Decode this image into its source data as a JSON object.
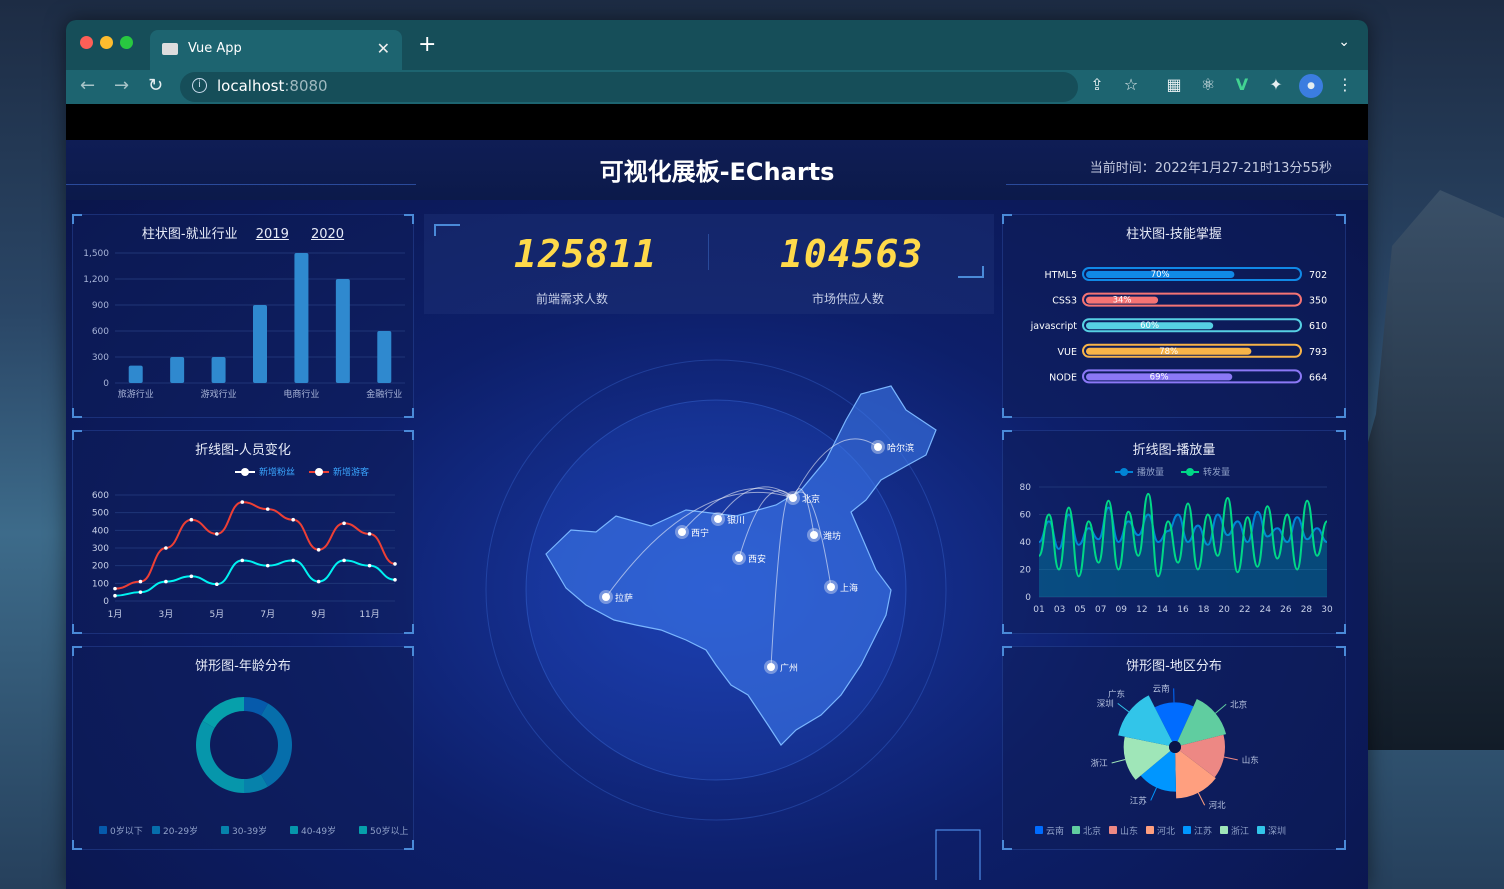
{
  "browser": {
    "tab_title": "Vue App",
    "url_host": "localhost",
    "url_port": ":8080"
  },
  "header": {
    "title": "可视化展板-ECharts",
    "time": "当前时间：2022年1月27-21时13分55秒"
  },
  "stats": [
    {
      "value": "125811",
      "label": "前端需求人数"
    },
    {
      "value": "104563",
      "label": "市场供应人数"
    }
  ],
  "bar1": {
    "title": "柱状图-就业行业",
    "years": [
      "2019",
      "2020"
    ],
    "chart_data": {
      "type": "bar",
      "categories": [
        "旅游行业",
        "",
        "游戏行业",
        "",
        "电商行业",
        "",
        "金融行业"
      ],
      "values": [
        200,
        300,
        300,
        900,
        1500,
        1200,
        600
      ],
      "yticks": [
        "0",
        "300",
        "600",
        "900",
        "1,200",
        "1,500"
      ],
      "ylim": [
        0,
        1500
      ]
    }
  },
  "line1": {
    "title": "折线图-人员变化",
    "chart_data": {
      "type": "line",
      "x": [
        "1月",
        "2月",
        "3月",
        "4月",
        "5月",
        "6月",
        "7月",
        "8月",
        "9月",
        "10月",
        "11月",
        "12月"
      ],
      "xticks": [
        "1月",
        "3月",
        "5月",
        "7月",
        "9月",
        "11月"
      ],
      "yticks": [
        "0",
        "100",
        "200",
        "300",
        "400",
        "500",
        "600"
      ],
      "ylim": [
        0,
        600
      ],
      "series": [
        {
          "name": "新增粉丝",
          "values": [
            30,
            50,
            110,
            140,
            95,
            230,
            200,
            230,
            110,
            230,
            200,
            120
          ]
        },
        {
          "name": "新增游客",
          "values": [
            70,
            110,
            300,
            460,
            380,
            560,
            520,
            460,
            290,
            440,
            380,
            210
          ]
        }
      ]
    }
  },
  "pie1": {
    "title": "饼形图-年龄分布",
    "chart_data": {
      "type": "pie",
      "legend": [
        "0岁以下",
        "20-29岁",
        "30-39岁",
        "40-49岁",
        "50岁以上"
      ],
      "values": [
        1,
        4,
        1,
        4,
        2
      ],
      "colors": [
        "#065aab",
        "#066eab",
        "#0682ab",
        "#0696ab",
        "#06a0ab"
      ]
    }
  },
  "skills": {
    "title": "柱状图-技能掌握",
    "chart_data": {
      "type": "bar",
      "categories": [
        "HTML5",
        "CSS3",
        "javascript",
        "VUE",
        "NODE"
      ],
      "percent": [
        70,
        34,
        60,
        78,
        69
      ],
      "percent_labels": [
        "70%",
        "34%",
        "60%",
        "78%",
        "69%"
      ],
      "totals": [
        "702",
        "350",
        "610",
        "793",
        "664"
      ],
      "colors": [
        "#1089e7",
        "#f57474",
        "#56d0e3",
        "#f8b448",
        "#8b78f6"
      ]
    }
  },
  "line2": {
    "title": "折线图-播放量",
    "chart_data": {
      "type": "line",
      "xticks": [
        "01",
        "03",
        "05",
        "07",
        "09",
        "12",
        "14",
        "16",
        "18",
        "20",
        "22",
        "24",
        "26",
        "28",
        "30"
      ],
      "yticks": [
        "0",
        "20",
        "40",
        "60",
        "80"
      ],
      "ylim": [
        0,
        80
      ],
      "series": [
        {
          "name": "播放量",
          "values": [
            40,
            55,
            35,
            60,
            38,
            50,
            42,
            65,
            40,
            55,
            45,
            60,
            40,
            48,
            60,
            40,
            52,
            38,
            60,
            45,
            55,
            40,
            62,
            44,
            50,
            40,
            58,
            42,
            50,
            40
          ]
        },
        {
          "name": "转发量",
          "values": [
            30,
            60,
            20,
            65,
            15,
            55,
            25,
            70,
            20,
            62,
            30,
            75,
            15,
            55,
            25,
            68,
            20,
            60,
            30,
            72,
            18,
            58,
            22,
            66,
            28,
            60,
            20,
            70,
            30,
            55
          ]
        }
      ]
    }
  },
  "pie2": {
    "title": "饼形图-地区分布",
    "chart_data": {
      "type": "pie",
      "legend": [
        "云南",
        "北京",
        "山东",
        "河北",
        "江苏",
        "浙江",
        "深圳"
      ],
      "values": [
        20,
        26,
        24,
        25,
        20,
        25,
        30
      ],
      "colors": [
        "#006cff",
        "#60cda0",
        "#ed8884",
        "#ff9f7f",
        "#0096ff",
        "#9fe6b8",
        "#32c5e9"
      ],
      "labels": [
        "云南",
        "北京",
        "山东",
        "河北",
        "江苏",
        "浙江",
        "深圳",
        "广东"
      ]
    }
  },
  "map": {
    "cities": [
      "哈尔滨",
      "北京",
      "银川",
      "西宁",
      "潍坊",
      "西安",
      "上海",
      "拉萨",
      "广州"
    ]
  }
}
